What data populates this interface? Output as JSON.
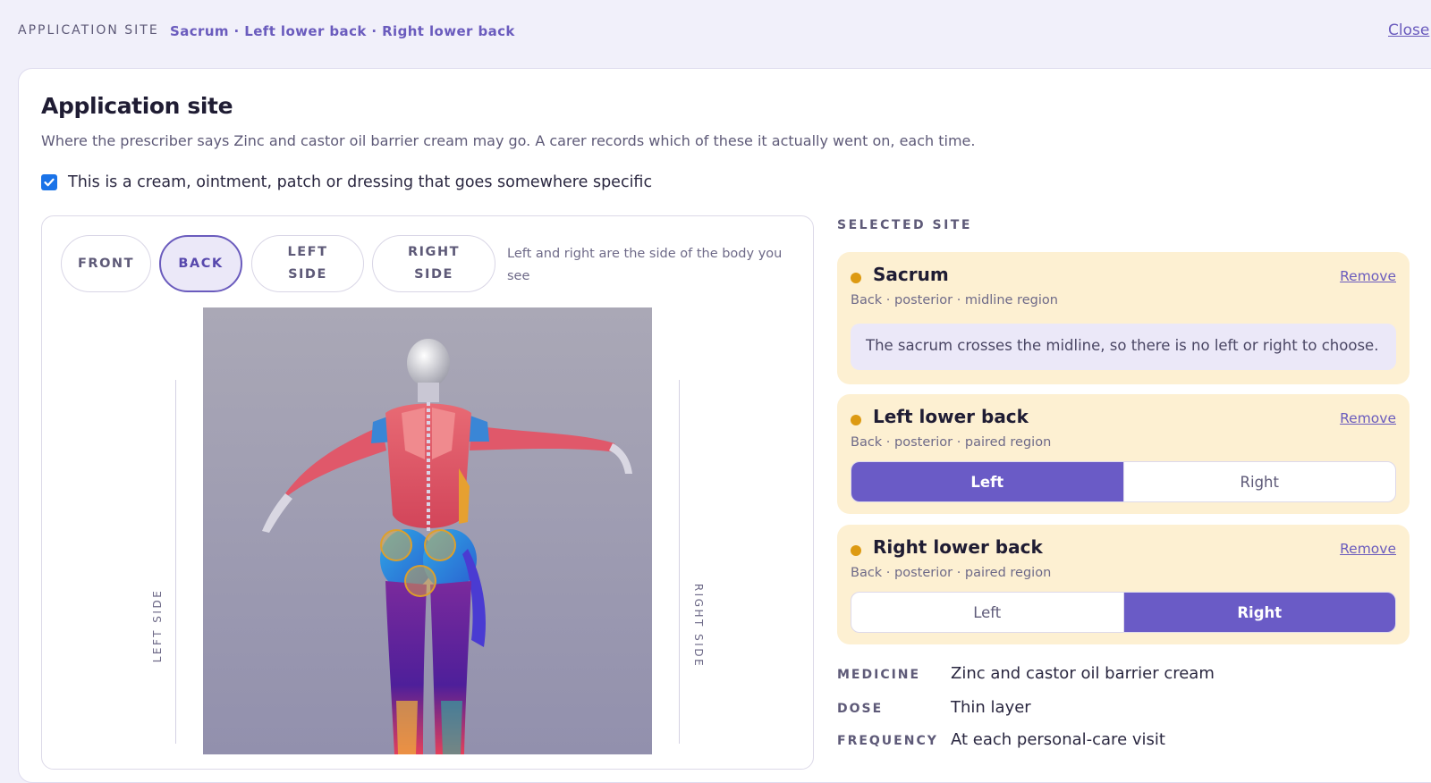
{
  "topbar": {
    "section_label": "APPLICATION SITE",
    "breadcrumb": "Sacrum · Left lower back · Right lower back",
    "close_label": "Close"
  },
  "panel": {
    "title": "Application site",
    "subtitle": "Where the prescriber says Zinc and castor oil barrier cream may go. A carer records which of these it actually went on, each time.",
    "checkbox": {
      "label": "This is a cream, ointment, patch or dressing that goes somewhere specific",
      "checked": true
    }
  },
  "viewer": {
    "views": [
      {
        "label": "FRONT",
        "active": false
      },
      {
        "label": "BACK",
        "active": true
      },
      {
        "label": "LEFT\nSIDE",
        "active": false
      },
      {
        "label": "RIGHT\nSIDE",
        "active": false
      }
    ],
    "note": "Left and right are the side of the body you see",
    "left_side_label": "LEFT SIDE",
    "right_side_label": "RIGHT SIDE"
  },
  "selected": {
    "heading": "SELECTED SITE",
    "sites": [
      {
        "name": "Sacrum",
        "meta": "Back · posterior · midline region",
        "remove_label": "Remove",
        "note": "The sacrum crosses the midline, so there is no left or right to choose."
      },
      {
        "name": "Left lower back",
        "meta": "Back · posterior · paired region",
        "remove_label": "Remove",
        "options": [
          "Left",
          "Right"
        ],
        "selected": "Left"
      },
      {
        "name": "Right lower back",
        "meta": "Back · posterior · paired region",
        "remove_label": "Remove",
        "options": [
          "Left",
          "Right"
        ],
        "selected": "Right"
      }
    ]
  },
  "details": {
    "medicine_label": "MEDICINE",
    "medicine_value": "Zinc and castor oil barrier cream",
    "dose_label": "DOSE",
    "dose_value": "Thin layer",
    "frequency_label": "FREQUENCY",
    "frequency_value": "At each personal-care visit"
  },
  "colors": {
    "accent": "#6a5bc6",
    "site_card_bg": "#fdf0d2",
    "site_dot": "#dd9a12",
    "checkbox": "#1a73e8"
  }
}
